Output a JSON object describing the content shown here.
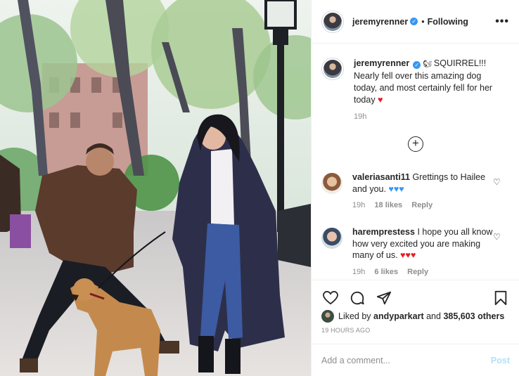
{
  "post": {
    "username": "jeremyrenner",
    "verified_icon": "verified-badge-icon",
    "follow_status": "Following",
    "separator": "•",
    "more_label": "•••"
  },
  "caption": {
    "username": "jeremyrenner",
    "text": "SQUIRREL!!! Nearly fell over this amazing dog today, and most certainly fell for her today",
    "heart": "♥",
    "time": "19h"
  },
  "load_more": {
    "label": "+"
  },
  "comments": [
    {
      "username": "valeriasanti11",
      "text": "Grettings to Hailee and you.",
      "hearts": "♥♥♥",
      "time": "19h",
      "likes": "18 likes",
      "reply": "Reply"
    },
    {
      "username": "haremprestess",
      "text": "I hope you all know how very excited you are making many of us.",
      "hearts": "♥♥♥",
      "time": "19h",
      "likes": "6 likes",
      "reply": "Reply"
    }
  ],
  "likes": {
    "prefix": "Liked by",
    "user": "andyparkart",
    "joiner": "and",
    "count": "385,603 others"
  },
  "posted_ago": "19 HOURS AGO",
  "comment_box": {
    "placeholder": "Add a comment...",
    "post_label": "Post"
  },
  "colors": {
    "link_blue": "#3897f0",
    "post_disabled": "#b2dffc",
    "heart_red": "#ed1c24"
  }
}
